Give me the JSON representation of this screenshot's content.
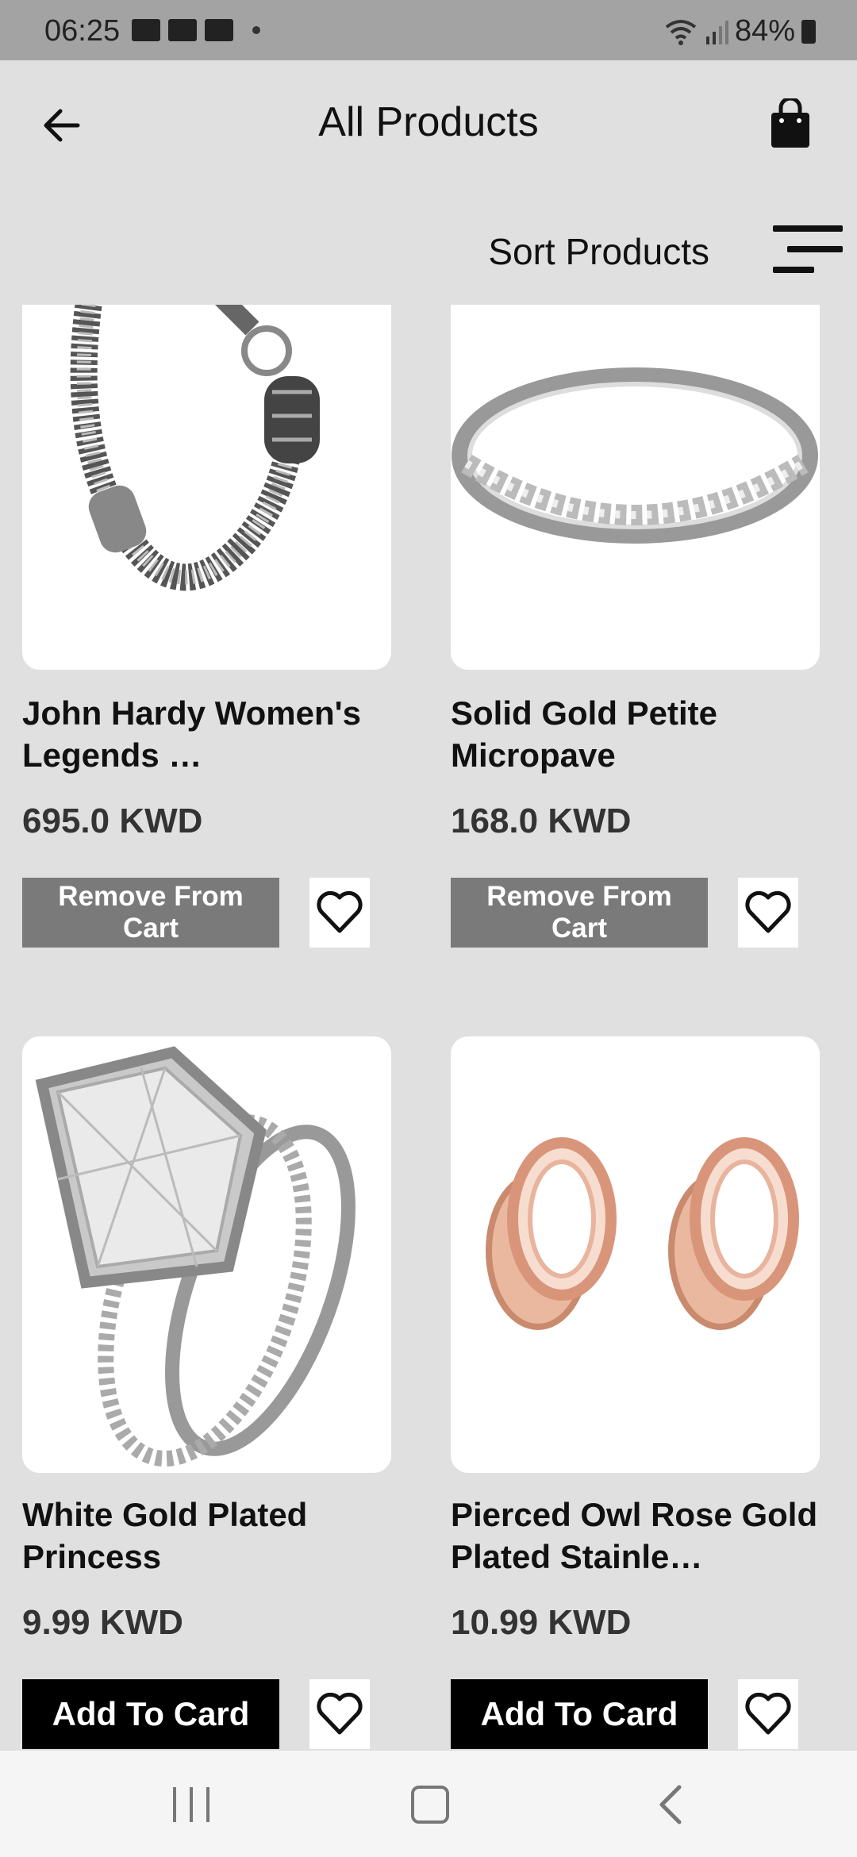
{
  "status_bar": {
    "time": "06:25",
    "battery": "84%",
    "icons": [
      "alpha-notification-icon",
      "alpha-notification-icon",
      "gallery-notification-icon",
      "wifi-icon",
      "signal-icon",
      "battery-icon"
    ]
  },
  "header": {
    "title": "All Products",
    "back_icon": "arrow-left-icon",
    "cart_icon": "shopping-bag-icon"
  },
  "sort": {
    "label": "Sort Products",
    "icon": "sort-lines-icon"
  },
  "products": [
    {
      "name": "John Hardy Women's Legends …",
      "price": "695.0 KWD",
      "action": "Remove From Cart",
      "in_cart": true,
      "image": "silver-chain-bracelet-image"
    },
    {
      "name": "Solid Gold Petite Micropave",
      "price": "168.0 KWD",
      "action": "Remove From Cart",
      "in_cart": true,
      "image": "silver-diamond-band-ring-image"
    },
    {
      "name": "White Gold Plated Princess",
      "price": "9.99 KWD",
      "action": "Add To Card",
      "in_cart": false,
      "image": "princess-cut-ring-set-image"
    },
    {
      "name": "Pierced Owl Rose Gold Plated Stainle…",
      "price": "10.99 KWD",
      "action": "Add To Card",
      "in_cart": false,
      "image": "rose-gold-ear-tunnels-image"
    }
  ],
  "nav_bar": {
    "recents_icon": "recents-icon",
    "home_icon": "home-icon",
    "back_icon": "nav-back-icon"
  },
  "colors": {
    "background": "#e0e0e0",
    "status_bar": "#a3a3a3",
    "remove_button": "#7a7a7a",
    "add_button": "#000000",
    "nav_bar": "#f5f5f5"
  }
}
